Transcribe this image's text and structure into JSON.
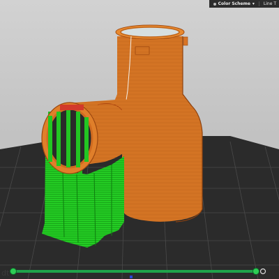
{
  "toolbar": {
    "color_scheme_label": "Color Scheme",
    "line_type_label": "Line T"
  },
  "slider": {
    "start": 0.0,
    "end": 0.96
  }
}
